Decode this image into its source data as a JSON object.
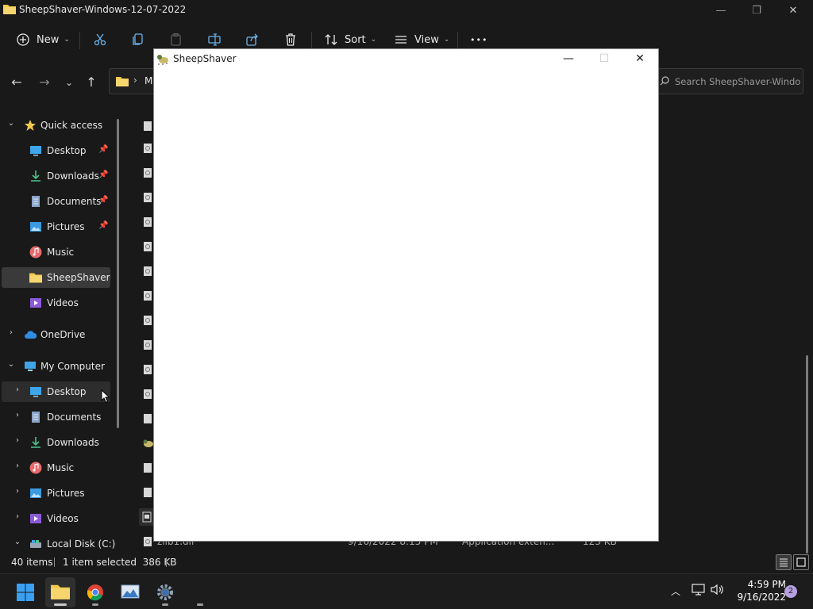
{
  "window": {
    "title": "SheepShaver-Windows-12-07-2022",
    "minimize": "—",
    "maximize": "❐",
    "close": "✕"
  },
  "toolbar": {
    "new_label": "New",
    "sort_label": "Sort",
    "view_label": "View",
    "more_label": "•••"
  },
  "address": {
    "path_prefix": "M",
    "search_placeholder": "Search SheepShaver-Windo..."
  },
  "sidebar": {
    "quick_access": "Quick access",
    "quick_items": [
      {
        "label": "Desktop",
        "pinned": true
      },
      {
        "label": "Downloads",
        "pinned": true
      },
      {
        "label": "Documents",
        "pinned": true
      },
      {
        "label": "Pictures",
        "pinned": true
      },
      {
        "label": "Music",
        "pinned": false
      },
      {
        "label": "SheepShaver-W",
        "pinned": false
      },
      {
        "label": "Videos",
        "pinned": false
      }
    ],
    "onedrive": "OneDrive",
    "my_computer": "My Computer",
    "computer_items": [
      {
        "label": "Desktop"
      },
      {
        "label": "Documents"
      },
      {
        "label": "Downloads"
      },
      {
        "label": "Music"
      },
      {
        "label": "Pictures"
      },
      {
        "label": "Videos"
      },
      {
        "label": "Local Disk (C:)"
      }
    ]
  },
  "filelist": {
    "last_row": {
      "name": "zlib1.dll",
      "date": "9/16/2022 8:15 PM",
      "type": "Application exten...",
      "size": "123 KB"
    }
  },
  "statusbar": {
    "item_count": "40 items",
    "selection": "1 item selected  386 KB"
  },
  "sheepshaver": {
    "title": "SheepShaver",
    "minimize": "—",
    "maximize": "☐",
    "close": "✕"
  },
  "taskbar": {
    "time": "4:59 PM",
    "date": "9/16/2022",
    "notifications": "2"
  },
  "colors": {
    "background": "#191919",
    "accent_folder": "#f2c94c",
    "taskbar": "#1c1c1c"
  }
}
